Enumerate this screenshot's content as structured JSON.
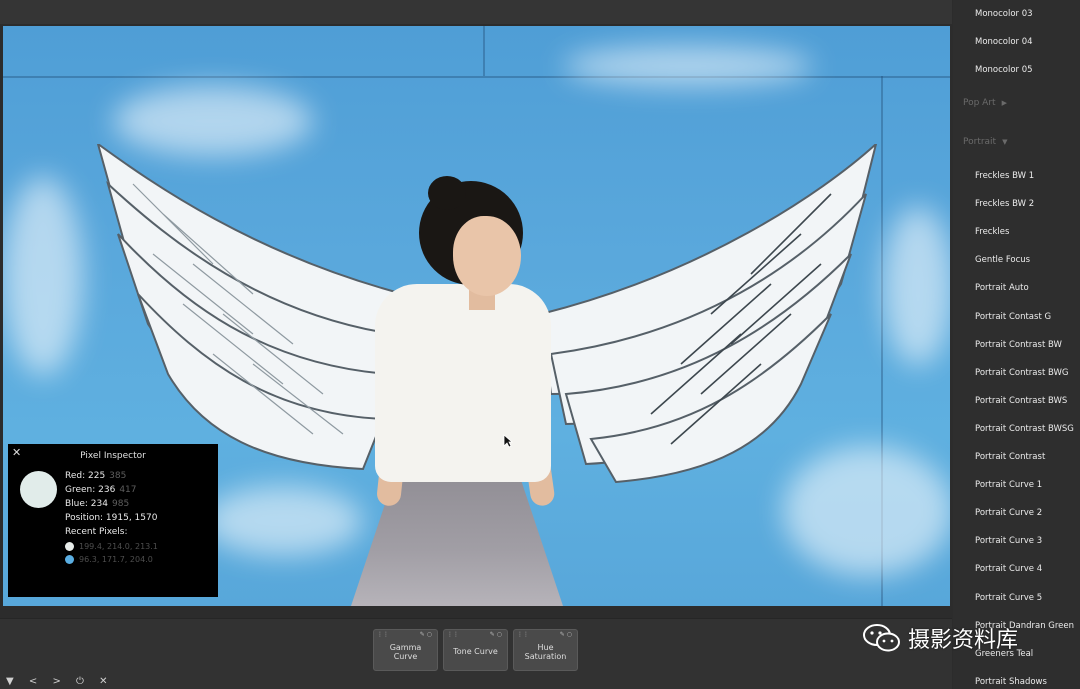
{
  "inspector": {
    "close_glyph": "✕",
    "title": "Pixel Inspector",
    "swatch_color": "#e1ecea",
    "red_label": "Red: 225",
    "red_extra": "385",
    "green_label": "Green: 236",
    "green_extra": "417",
    "blue_label": "Blue: 234",
    "blue_extra": "985",
    "position_label": "Position: 1915, 1570",
    "recent_label": "Recent Pixels:",
    "recent": [
      {
        "color": "#e6ebe9",
        "value": "199.4, 214.0, 213.1"
      },
      {
        "color": "#5aaee2",
        "value": "96.3, 171.7, 204.0"
      }
    ]
  },
  "sidebar": {
    "items_top": [
      "Monocolor 03",
      "Monocolor 04",
      "Monocolor 05"
    ],
    "cat_pop_art": "Pop Art",
    "cat_portrait": "Portrait",
    "portrait_items": [
      "Freckles BW 1",
      "Freckles BW 2",
      "Freckles",
      "Gentle Focus",
      "Portrait Auto",
      "Portrait Contast G",
      "Portrait Contrast BW",
      "Portrait Contrast BWG",
      "Portrait Contrast BWS",
      "Portrait Contrast BWSG",
      "Portrait Contrast",
      "Portrait Curve 1",
      "Portrait Curve 2",
      "Portrait Curve 3",
      "Portrait Curve 4",
      "Portrait Curve 5",
      "Portrait Dandran Green",
      "Greeners Teal",
      "Portrait Shadows"
    ]
  },
  "tools": {
    "gamma": "Gamma\nCurve",
    "gamma_l1": "Gamma",
    "gamma_l2": "Curve",
    "tone": "Tone Curve",
    "hue_l1": "Hue",
    "hue_l2": "Saturation"
  },
  "nav": {
    "menu": "▼",
    "prev": "<",
    "next": ">",
    "power": "⏻",
    "close": "✕"
  },
  "watermark": {
    "text": "摄影资料库"
  }
}
